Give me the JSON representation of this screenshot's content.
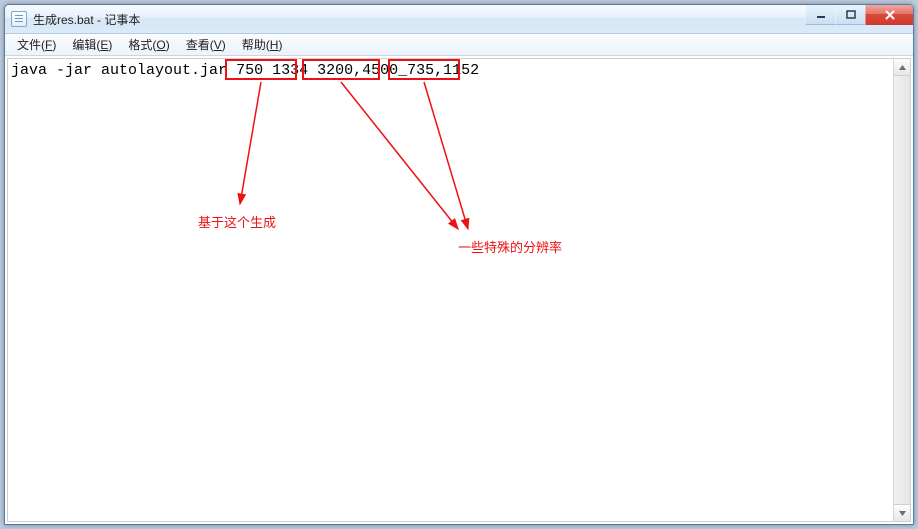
{
  "window": {
    "title": "生成res.bat - 记事本"
  },
  "menubar": {
    "items": [
      {
        "label": "文件",
        "accel": "F"
      },
      {
        "label": "编辑",
        "accel": "E"
      },
      {
        "label": "格式",
        "accel": "O"
      },
      {
        "label": "查看",
        "accel": "V"
      },
      {
        "label": "帮助",
        "accel": "H"
      }
    ]
  },
  "content": {
    "cmd_prefix": "java -jar autolayout.jar",
    "arg1": "750 1334",
    "arg2": "3200,4500",
    "sep": "_",
    "arg3": "735,1152"
  },
  "annotations": {
    "label1": "基于这个生成",
    "label2": "一些特殊的分辨率"
  },
  "win_controls": {
    "min": "minimize",
    "max": "maximize",
    "close": "close"
  }
}
